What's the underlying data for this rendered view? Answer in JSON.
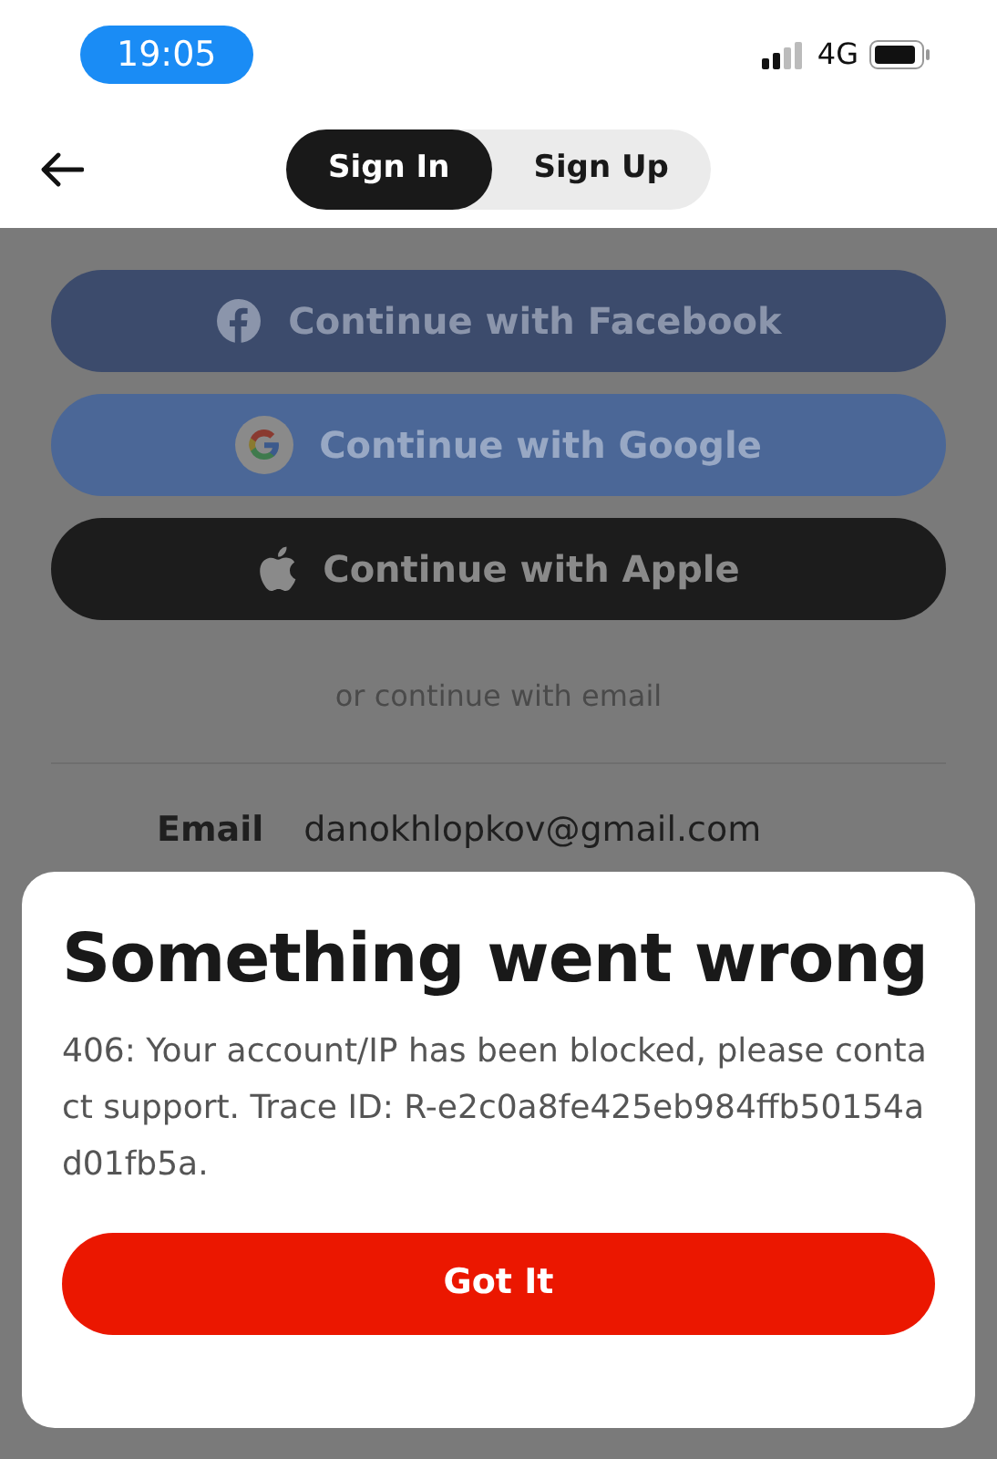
{
  "status_bar": {
    "time": "19:05",
    "network": "4G"
  },
  "tabs": [
    {
      "label": "Sign In",
      "selected": true
    },
    {
      "label": "Sign Up",
      "selected": false
    }
  ],
  "social_buttons": [
    {
      "kind": "facebook",
      "label": "Continue with Facebook"
    },
    {
      "kind": "google",
      "label": "Continue with Google"
    },
    {
      "kind": "apple",
      "label": "Continue with Apple"
    }
  ],
  "separator_text": "or continue with email",
  "email": {
    "label": "Email",
    "value": "danokhlopkov@gmail.com"
  },
  "dialog": {
    "title": "Something went wrong",
    "message": "406: Your account/IP has been blocked, please contact support. Trace ID: R-e2c0a8fe425eb984ffb50154ad01fb5a.",
    "button": "Got It"
  }
}
